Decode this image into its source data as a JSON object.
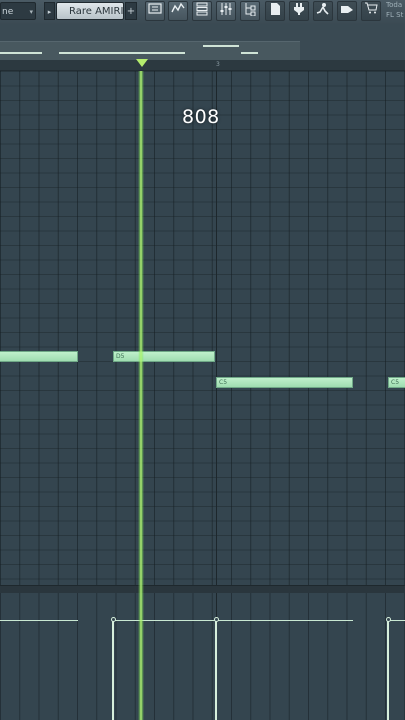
{
  "toolbar": {
    "mode_value": "ne",
    "pattern_name": "Rare AMIRI",
    "pattern_add": "+",
    "pattern_prev": "▸",
    "hint_line1": "Toda",
    "hint_line2": "FL St",
    "icons": [
      "piano-roll-icon",
      "playlist-icon",
      "channel-rack-icon",
      "mixer-icon",
      "browser-icon",
      "plugin-icon",
      "project-icon",
      "audio-icon",
      "metronome-icon",
      "shop-icon"
    ]
  },
  "timeline": {
    "bar_label": "3"
  },
  "grid": {
    "title": "808"
  },
  "notes": [
    {
      "label": ""
    },
    {
      "label": "D5"
    },
    {
      "label": "C5"
    },
    {
      "label": "C5"
    }
  ]
}
